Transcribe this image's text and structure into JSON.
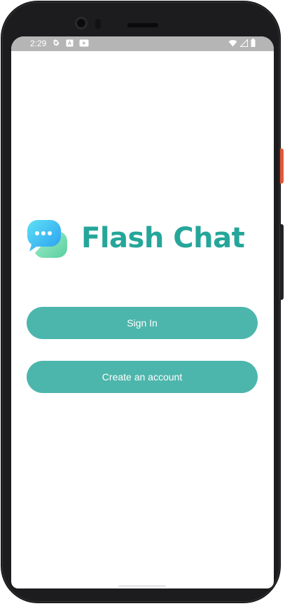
{
  "status_bar": {
    "time": "2:29",
    "left_icons": [
      "gear-icon",
      "a-badge-icon",
      "play-icon"
    ],
    "right_icons": [
      "wifi-icon",
      "signal-icon",
      "battery-icon"
    ]
  },
  "app": {
    "title": "Flash Chat",
    "logo_icon": "chat-bubbles-icon"
  },
  "buttons": {
    "sign_in": "Sign In",
    "create_account": "Create an account"
  },
  "colors": {
    "accent": "#26a69a",
    "button": "#4db6ac",
    "status_bar": "#b5b5b5"
  }
}
